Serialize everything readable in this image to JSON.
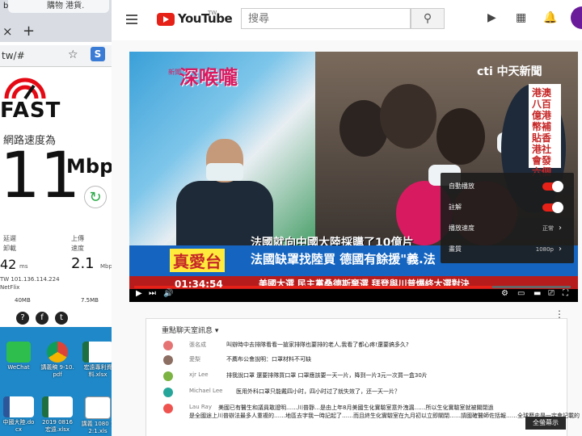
{
  "left_browser": {
    "tab_bit": "bit",
    "tab_title": "購物 港貨.",
    "close_glyph": "×",
    "new_tab_glyph": "+",
    "url": "tw/#",
    "ext_label": "S",
    "fast_word": "FAST",
    "speed_caption": "網路速度為",
    "speed_value": "11",
    "speed_unit": "Mbps",
    "refresh_glyph": "↻",
    "latency_label": "延遲",
    "latency_sub": "卸載",
    "latency_value": "42",
    "latency_unit": "ms",
    "upload_label": "上傳",
    "upload_sub": "速度",
    "upload_value": "2.1",
    "upload_unit": "Mbps",
    "server": "TW   101.136.114.224",
    "isp": "NetFlix",
    "bytes_down": "40MB",
    "bytes_up": "7.5MB",
    "social": [
      "?",
      "f",
      "t"
    ]
  },
  "desktop_icons": [
    {
      "label": "WeChat",
      "color": "#2dbe4e"
    },
    {
      "label": "講義稿 9-10.pdf",
      "color": "#e0e0e0"
    },
    {
      "label": "宏遠專利資料.xlsx",
      "color": "#1d6f42"
    },
    {
      "label": "中國大陸.docx",
      "color": "#2b579a"
    },
    {
      "label": "2019 0816 宏遠.xlsx",
      "color": "#1d6f42"
    },
    {
      "label": "講義 1080 12:1.xls",
      "color": "#ffffff"
    }
  ],
  "youtube": {
    "logo_word": "YouTube",
    "region": "TW",
    "search_placeholder": "搜尋",
    "search_glyph": "⚲",
    "icons": {
      "video": "▶",
      "apps": "▦",
      "bell": "🔔"
    },
    "show_logo": "深喉嚨",
    "show_logo_small": "新聞",
    "channel": "cti 中天新聞",
    "side_text": "港澳八百億港幣補貼香港社會發六個",
    "ticker_top": "法國就向中國大陸採購了10億片",
    "banner_left": "真愛台",
    "banner_right": "法國缺罩找陸買 德國有餘援\"義.法",
    "ticker_bottom": "美國大選  民主黨桑德斯棄選  拜登與川普爆終大選對決",
    "time": "01:34:54",
    "progress": 0.82,
    "settings": [
      {
        "label": "自動播放",
        "kind": "toggle"
      },
      {
        "label": "註解",
        "kind": "toggle"
      },
      {
        "label": "播放速度",
        "value": "正常",
        "kind": "menu"
      },
      {
        "label": "畫質",
        "value": "1080p",
        "kind": "menu"
      }
    ],
    "more_glyph": "⋮",
    "chat_title": "重點聊天室訊息 ▾",
    "chat": [
      {
        "name": "張名成",
        "msg": "叫辦時中去排隊看看一搶家排隊也要排的老人,我看了都心疼!還要搞多久?",
        "color": "#e57373"
      },
      {
        "name": "愛梨",
        "msg": "不薦布公會說明：口罩材料不可缺",
        "color": "#8d6e63"
      },
      {
        "name": "xjr Lee",
        "msg": "排我說口罩 還要排隊買口罩 口罩應該要一天一片，降到一片3元一次買一盒30片",
        "color": "#7cb342"
      },
      {
        "name": "Michael Lee",
        "msg": "医用外科口罩只能戴四小时，四小时过了就失效了，还一天一片？",
        "color": "#26a69a"
      },
      {
        "name": "Lau Ray",
        "msg": "美國已有醫生和議員敢證明……川普靜…是由上年8月美國生化實驗室意外洩漏……所以生化實驗室就被關閉過",
        "msg2": "是全國途上川普辦法最多人重複的……地區去字我一時記起了……而且終生化實驗室在九月初以立即關閉……請國確醫師佐括報……全球歷史是一定會記載的",
        "color": "#ef5350"
      }
    ],
    "fullscreen_label": "全螢幕示"
  }
}
